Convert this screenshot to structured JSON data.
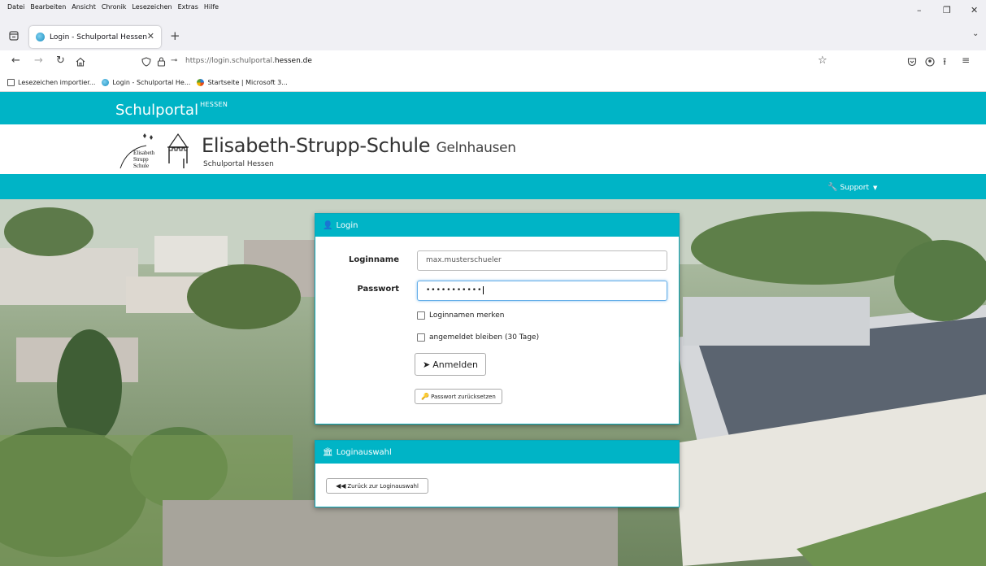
{
  "browser": {
    "menu": [
      "Datei",
      "Bearbeiten",
      "Ansicht",
      "Chronik",
      "Lesezeichen",
      "Extras",
      "Hilfe"
    ],
    "tab_title": "Login - Schulportal Hessen",
    "url_prefix": "https://login.schulportal.",
    "url_domain": "hessen.de",
    "bookmarks": [
      "Lesezeichen importier...",
      "Login - Schulportal He...",
      "Startseite | Microsoft 3..."
    ]
  },
  "portal": {
    "brand": "Schulportal",
    "brand_sup": "HESSEN"
  },
  "school": {
    "name": "Elisabeth-Strupp-Schule",
    "city": "Gelnhausen",
    "subtitle": "Schulportal Hessen",
    "logo_text": [
      "Elisabeth",
      "Strupp",
      "Schule"
    ]
  },
  "nav": {
    "support": "Support"
  },
  "login": {
    "title": "Login",
    "username_label": "Loginname",
    "username_value": "max.musterschueler",
    "password_label": "Passwort",
    "password_value": "•••••••••••",
    "remember_label": "Loginnamen merken",
    "stay_label": "angemeldet bleiben (30 Tage)",
    "submit_label": "Anmelden",
    "reset_label": "Passwort zurücksetzen"
  },
  "choice": {
    "title": "Loginauswahl",
    "back_label": "Zurück zur Loginauswahl"
  },
  "colors": {
    "accent": "#00b4c6"
  }
}
